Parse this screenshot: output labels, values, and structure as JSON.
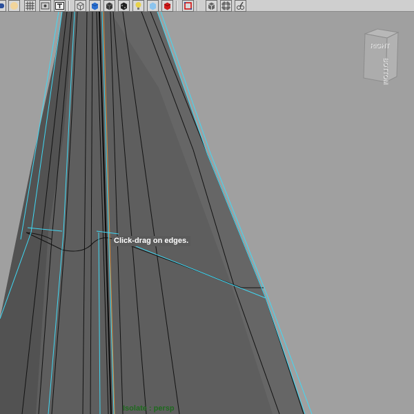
{
  "toolbar": {
    "buttons": [
      {
        "name": "select-camera-icon",
        "color": "#2a4f9c"
      },
      {
        "name": "light-bulb-icon",
        "color": "#f2d49b"
      },
      {
        "name": "grid-icon",
        "color": "#444444"
      },
      {
        "name": "film-gate-icon",
        "color": "#444444"
      },
      {
        "name": "text-icon",
        "color": "#222222"
      },
      {
        "name": "wireframe-cube-icon",
        "color": "#555555"
      },
      {
        "name": "smooth-shade-cube-icon",
        "color": "#2a6fd0"
      },
      {
        "name": "shaded-cube-icon",
        "color": "#3a3a3a"
      },
      {
        "name": "textured-cube-icon",
        "color": "#222222"
      },
      {
        "name": "default-light-icon",
        "color": "#e8d24a"
      },
      {
        "name": "all-lights-icon",
        "color": "#8bc4ee"
      },
      {
        "name": "shadows-cube-icon",
        "color": "#d11c1c"
      },
      {
        "name": "xray-icon",
        "color": "#d00000"
      },
      {
        "name": "isolate-select-icon",
        "color": "#666666"
      },
      {
        "name": "grid-toggle-icon",
        "color": "#444444"
      },
      {
        "name": "camera-tool-icon",
        "color": "#444444"
      }
    ]
  },
  "viewport": {
    "hint_text": "Click-drag on edges.",
    "hud_isolate": "Isolate : persp",
    "viewcube": {
      "face_top": "RIGHT",
      "face_side": "BOTTOM"
    },
    "colors": {
      "background": "#a0a0a0",
      "mesh_fill": "#5e5e5e",
      "mesh_edge": "#111111",
      "selection_edge": "#3fd9f5",
      "highlight_edge": "#d98a3a"
    }
  }
}
